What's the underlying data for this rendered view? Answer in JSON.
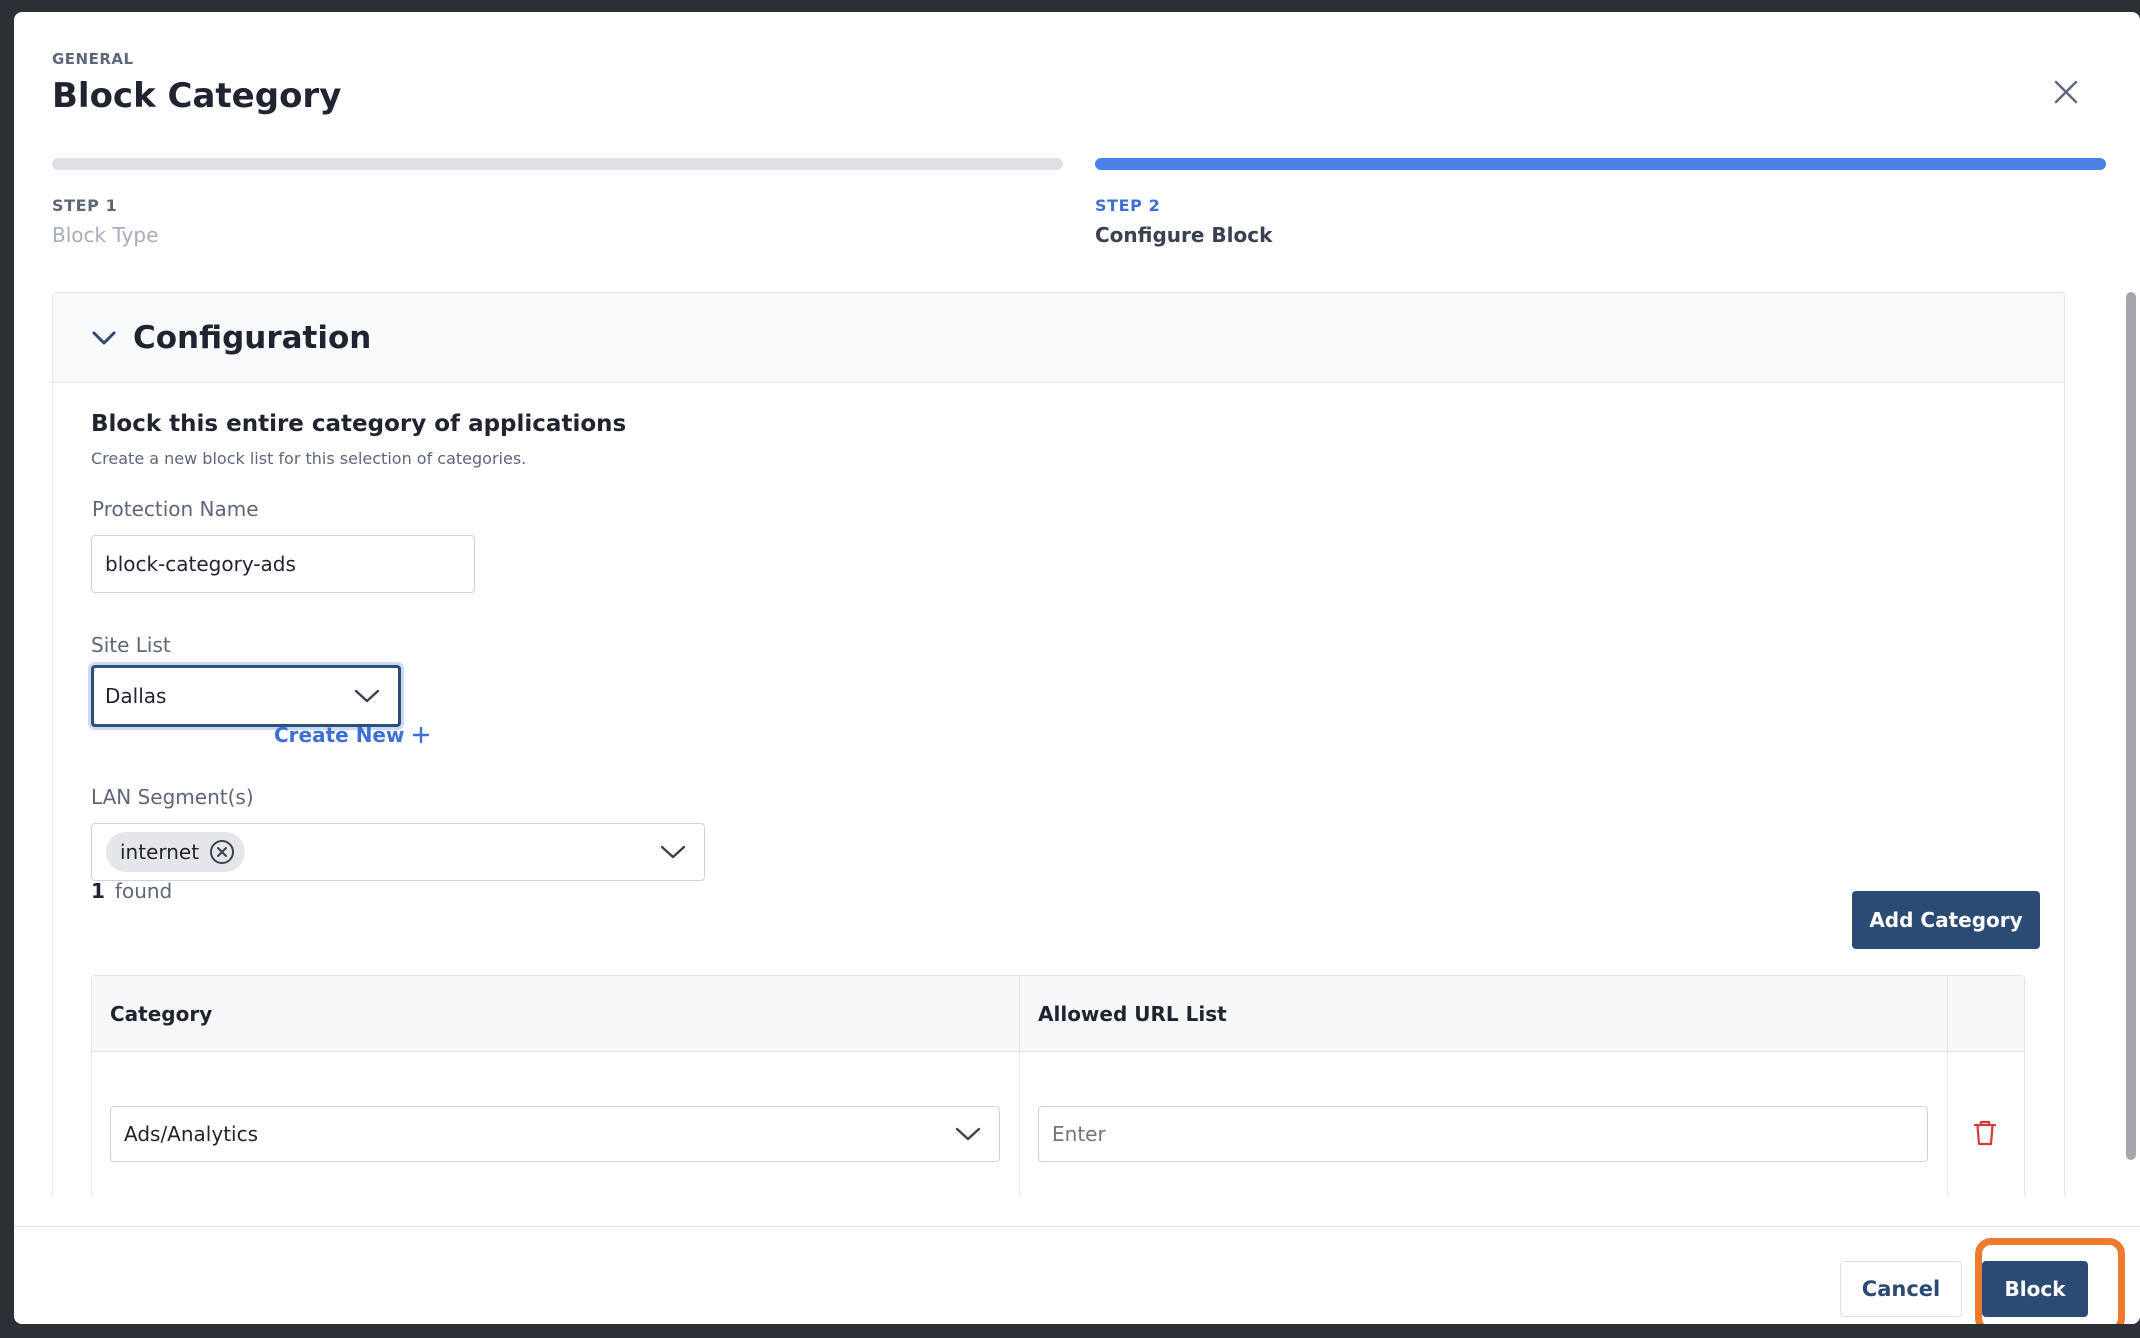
{
  "header": {
    "eyebrow": "GENERAL",
    "title": "Block Category"
  },
  "steps": [
    {
      "number": "STEP 1",
      "label": "Block Type",
      "active": false
    },
    {
      "number": "STEP 2",
      "label": "Configure Block",
      "active": true
    }
  ],
  "configuration": {
    "header": "Configuration",
    "section_title": "Block this entire category of applications",
    "section_subtitle": "Create a new block list for this selection of categories.",
    "protection_name": {
      "label": "Protection Name",
      "value": "block-category-ads"
    },
    "site_list": {
      "label": "Site List",
      "selected": "Dallas",
      "create_new": "Create New"
    },
    "lan_segments": {
      "label": "LAN Segment(s)",
      "chips": [
        "internet"
      ]
    },
    "found_count": "1",
    "found_label": "found",
    "add_category": "Add Category",
    "table": {
      "columns": [
        "Category",
        "Allowed URL List",
        ""
      ],
      "rows": [
        {
          "category": "Ads/Analytics",
          "allowed_url_placeholder": "Enter"
        }
      ]
    }
  },
  "footer": {
    "cancel": "Cancel",
    "block": "Block"
  },
  "colors": {
    "primary": "#2c4b74",
    "step_active": "#4a80e8",
    "link": "#3d6fd4",
    "delete": "#d23b3b",
    "highlight": "#ee7a31"
  }
}
